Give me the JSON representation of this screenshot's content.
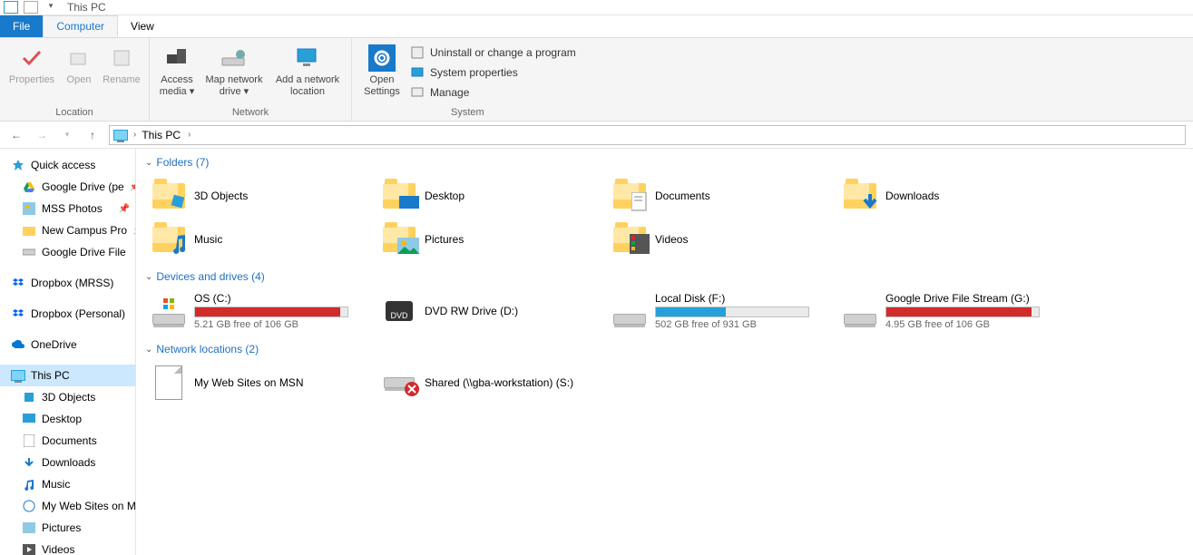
{
  "window": {
    "title": "This PC"
  },
  "tabs": {
    "file": "File",
    "computer": "Computer",
    "view": "View"
  },
  "ribbon": {
    "location": {
      "label": "Location",
      "properties": "Properties",
      "open": "Open",
      "rename": "Rename"
    },
    "network": {
      "label": "Network",
      "access_media": "Access media ▾",
      "map_drive": "Map network drive ▾",
      "add_location": "Add a network location"
    },
    "system": {
      "label": "System",
      "open_settings": "Open Settings",
      "uninstall": "Uninstall or change a program",
      "sys_props": "System properties",
      "manage": "Manage"
    }
  },
  "breadcrumb": {
    "root": "This PC"
  },
  "navpane": {
    "quick": "Quick access",
    "pins": [
      {
        "label": "Google Drive (pe"
      },
      {
        "label": "MSS Photos"
      },
      {
        "label": "New Campus Pro"
      },
      {
        "label": "Google Drive File"
      }
    ],
    "dropbox1": "Dropbox (MRSS)",
    "dropbox2": "Dropbox (Personal)",
    "onedrive": "OneDrive",
    "thispc": "This PC",
    "pcchildren": [
      "3D Objects",
      "Desktop",
      "Documents",
      "Downloads",
      "Music",
      "My Web Sites on M",
      "Pictures",
      "Videos"
    ]
  },
  "sections": {
    "folders": {
      "title": "Folders (7)",
      "items": [
        "3D Objects",
        "Desktop",
        "Documents",
        "Downloads",
        "Music",
        "Pictures",
        "Videos"
      ]
    },
    "drives": {
      "title": "Devices and drives (4)",
      "items": [
        {
          "name": "OS (C:)",
          "sub": "5.21 GB free of 106 GB",
          "color": "red",
          "pct": 95
        },
        {
          "name": "DVD RW Drive (D:)",
          "sub": "",
          "kind": "dvd"
        },
        {
          "name": "Local Disk (F:)",
          "sub": "502 GB free of 931 GB",
          "color": "blue",
          "pct": 46
        },
        {
          "name": "Google Drive File Stream (G:)",
          "sub": "4.95 GB free of 106 GB",
          "color": "red",
          "pct": 95
        }
      ]
    },
    "netloc": {
      "title": "Network locations (2)",
      "items": [
        {
          "name": "My Web Sites on MSN",
          "kind": "file"
        },
        {
          "name": "Shared (\\\\gba-workstation) (S:)",
          "kind": "netdrive-x"
        }
      ]
    }
  }
}
